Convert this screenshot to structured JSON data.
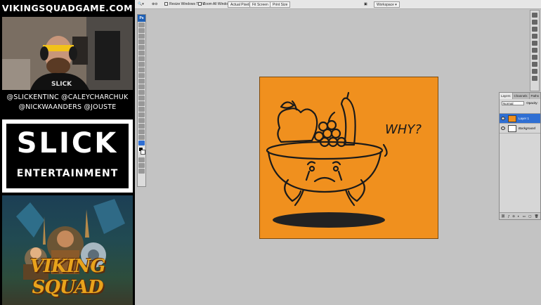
{
  "overlay": {
    "site_title": "VIKINGSQUADGAME.COM",
    "handles_line1": "@SLICKENTINC @CALEYCHARCHUK",
    "handles_line2": "@NICKWAANDERS @JOUSTE",
    "sponsor_word": "SLICK",
    "sponsor_sub": "ENTERTAINMENT",
    "game_logo": "VIKING SQUAD"
  },
  "photoshop": {
    "options_bar": {
      "resize_windows_label": "Resize Windows To Fit",
      "zoom_all_label": "Zoom All Windows",
      "actual_pixels": "Actual Pixels",
      "fit_screen": "Fit Screen",
      "print_size": "Print Size",
      "workspace": "Workspace ▾"
    },
    "toolbox_label": "Ps",
    "canvas": {
      "background_color": "#f0901e",
      "speech_text": "WHY?"
    },
    "layers_panel": {
      "tabs": [
        "Layers",
        "Channels",
        "Paths"
      ],
      "blend_mode": "Normal",
      "opacity_label": "Opacity:",
      "layers": [
        {
          "name": "Layer 1",
          "selected": true
        },
        {
          "name": "Background",
          "selected": false
        }
      ]
    }
  }
}
